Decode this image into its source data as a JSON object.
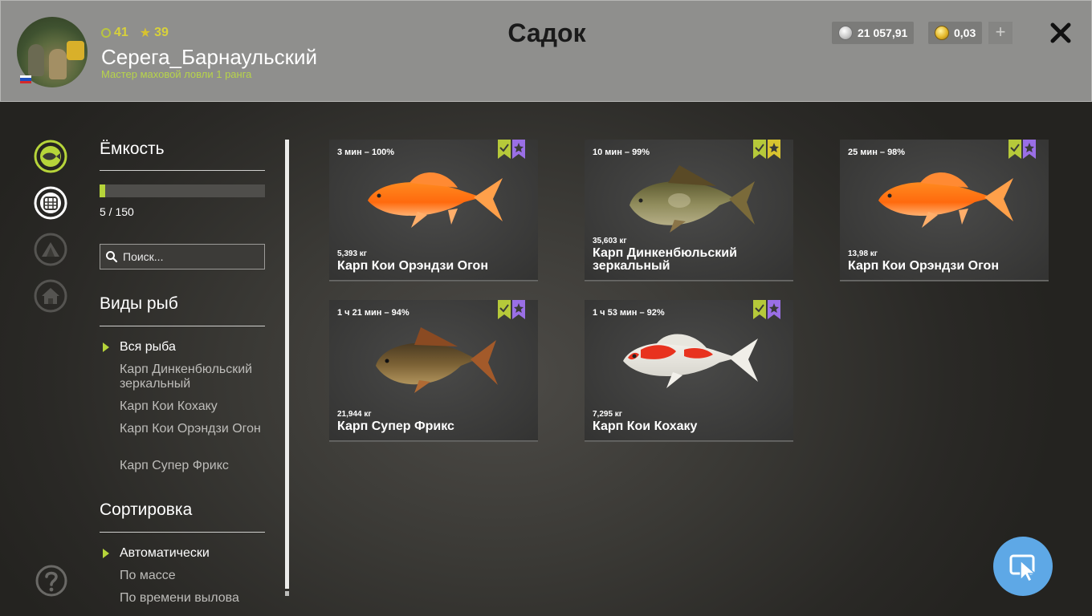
{
  "header": {
    "title": "Садок",
    "player": {
      "level": "41",
      "rank": "39",
      "name": "Серега_Барнаульский",
      "title": "Мастер маховой ловли 1 ранга"
    },
    "silver": "21 057,91",
    "gold": "0,03",
    "plus_label": "+"
  },
  "sidebar": {
    "capacity_title": "Ёмкость",
    "capacity_used": 5,
    "capacity_max": 150,
    "capacity_text": "5 / 150",
    "search_placeholder": "Поиск...",
    "species_title": "Виды рыб",
    "species": [
      "Вся рыба",
      "Карп Динкенбюльский зеркальный",
      "Карп Кои Кохаку",
      "Карп Кои Орэндзи Огон",
      "Карп Супер Фрикс"
    ],
    "sort_title": "Сортировка",
    "sort": [
      "Автоматически",
      "По массе",
      "По времени вылова"
    ]
  },
  "cards": [
    {
      "time": "3 мин – 100%",
      "weight": "5,393 кг",
      "name": "Карп Кои Орэндзи Огон",
      "badge2": "purple"
    },
    {
      "time": "10 мин – 99%",
      "weight": "35,603 кг",
      "name": "Карп Динкенбюльский зеркальный",
      "badge2": "yellow"
    },
    {
      "time": "25 мин – 98%",
      "weight": "13,98 кг",
      "name": "Карп Кои Орэндзи Огон",
      "badge2": "purple"
    },
    {
      "time": "1 ч 21 мин – 94%",
      "weight": "21,944 кг",
      "name": "Карп Супер Фрикс",
      "badge2": "purple"
    },
    {
      "time": "1 ч 53 мин – 92%",
      "weight": "7,295 кг",
      "name": "Карп Кои Кохаку",
      "badge2": "purple"
    }
  ],
  "colors": {
    "accent": "#b6d43a",
    "badge_check": "#b6c93a",
    "badge_purple": "#9a6fe6",
    "badge_yellow": "#d8c32f",
    "cursor_button": "#5ea8e6"
  }
}
